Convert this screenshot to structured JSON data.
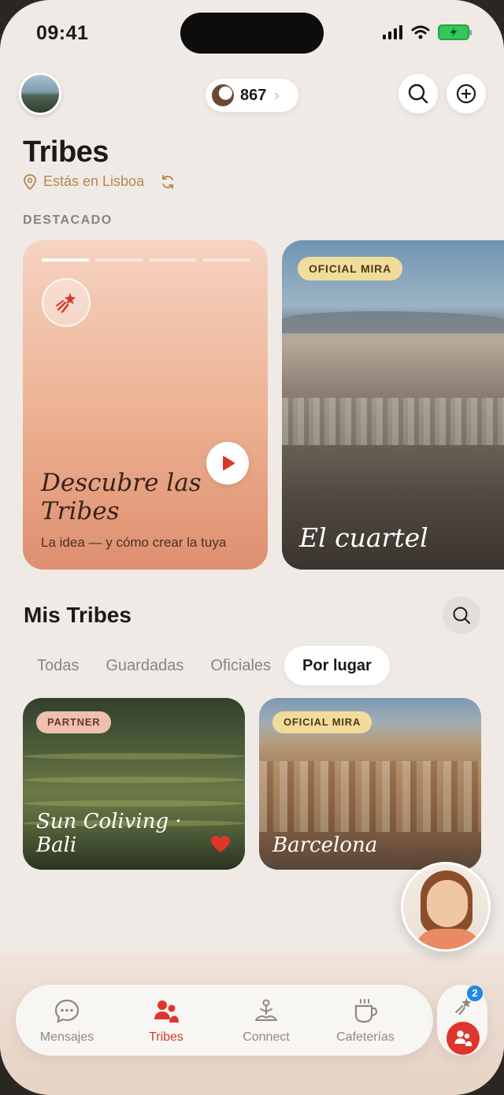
{
  "status": {
    "time": "09:41"
  },
  "header": {
    "coins": "867",
    "coins_chevron": "›"
  },
  "page": {
    "title": "Tribes",
    "location": "Estás en Lisboa",
    "featured_label": "DESTACADO"
  },
  "featured": [
    {
      "title": "Descubre las Tribes",
      "subtitle": "La idea — y cómo crear la tuya",
      "story_segments": 4,
      "active_segment": 1
    },
    {
      "badge": "OFICIAL MIRA",
      "title": "El cuartel"
    }
  ],
  "mis_tribes": {
    "title": "Mis Tribes",
    "tabs": [
      "Todas",
      "Guardadas",
      "Oficiales",
      "Por lugar"
    ],
    "active_tab": "Por lugar",
    "items": [
      {
        "badge": "PARTNER",
        "title": "Sun Coliving · Bali",
        "favorite": true
      },
      {
        "badge": "OFICIAL MIRA",
        "title": "Barcelona",
        "favorite": false
      }
    ]
  },
  "nav": {
    "items": [
      {
        "label": "Mensajes",
        "icon": "chat-bubble-icon"
      },
      {
        "label": "Tribes",
        "icon": "people-icon"
      },
      {
        "label": "Connect",
        "icon": "meditation-icon"
      },
      {
        "label": "Cafeterías",
        "icon": "coffee-cup-icon"
      }
    ],
    "active": "Tribes",
    "side_badge": "2"
  },
  "colors": {
    "accent": "#d9372d",
    "gold": "#b5864f",
    "background": "#efeae5"
  }
}
